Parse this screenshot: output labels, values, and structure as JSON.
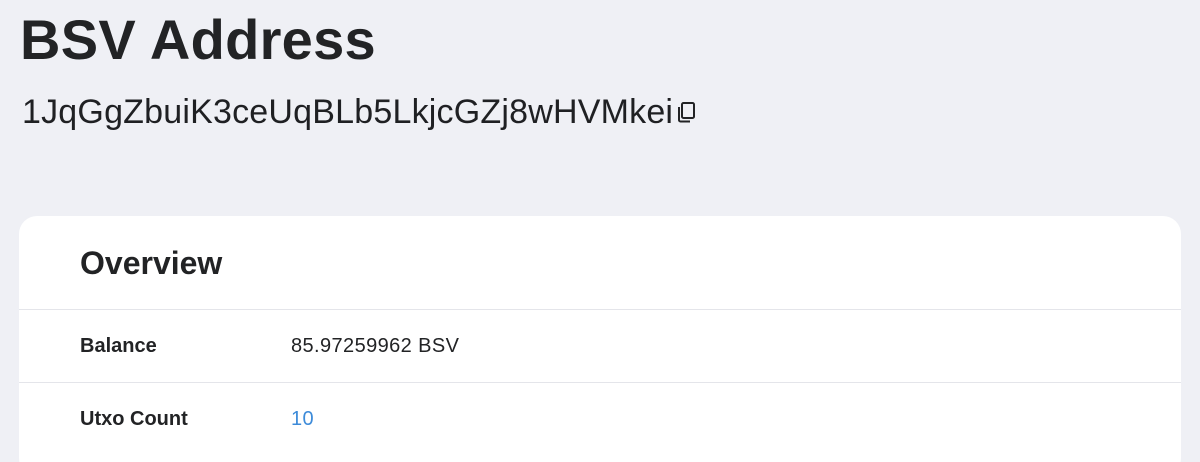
{
  "page": {
    "title": "BSV Address",
    "address": "1JqGgZbuiK3ceUqBLb5LkjcGZj8wHVMkei",
    "copy_icon": "copy-icon"
  },
  "overview": {
    "title": "Overview",
    "rows": [
      {
        "label": "Balance",
        "value": "85.97259962 BSV"
      },
      {
        "label": "Utxo Count",
        "value": "10"
      }
    ]
  },
  "colors": {
    "background": "#eff0f5",
    "card": "#ffffff",
    "link": "#3d8bd9",
    "text": "#222325"
  }
}
